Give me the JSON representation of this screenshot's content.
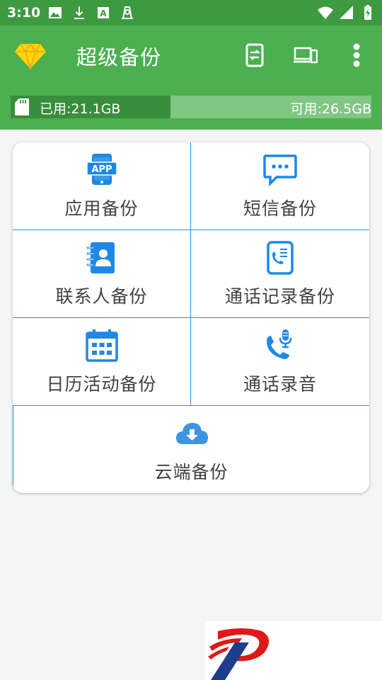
{
  "status_bar": {
    "time": "3:10",
    "left_icons": [
      "image-icon",
      "download-icon",
      "a-box-icon",
      "sim-icon"
    ],
    "right_icons": [
      "wifi-icon",
      "signal-icon",
      "battery-charging-icon"
    ]
  },
  "app_bar": {
    "title": "超级备份",
    "logo_icon": "diamond-icon",
    "actions": [
      "phone-switch-icon",
      "devices-icon",
      "more-vert-icon"
    ],
    "color": "#4caf50"
  },
  "storage": {
    "used_label": "已用:21.1GB",
    "free_label": "可用:26.5GB",
    "used_fraction": 0.443
  },
  "grid": {
    "accent": "#2196f3",
    "items": [
      {
        "label": "应用备份",
        "icon": "app-icon"
      },
      {
        "label": "短信备份",
        "icon": "sms-icon"
      },
      {
        "label": "联系人备份",
        "icon": "contacts-icon"
      },
      {
        "label": "通话记录备份",
        "icon": "call-log-icon"
      },
      {
        "label": "日历活动备份",
        "icon": "calendar-icon"
      },
      {
        "label": "通话录音",
        "icon": "call-record-icon"
      },
      {
        "label": "云端备份",
        "icon": "cloud-download-icon"
      }
    ]
  }
}
